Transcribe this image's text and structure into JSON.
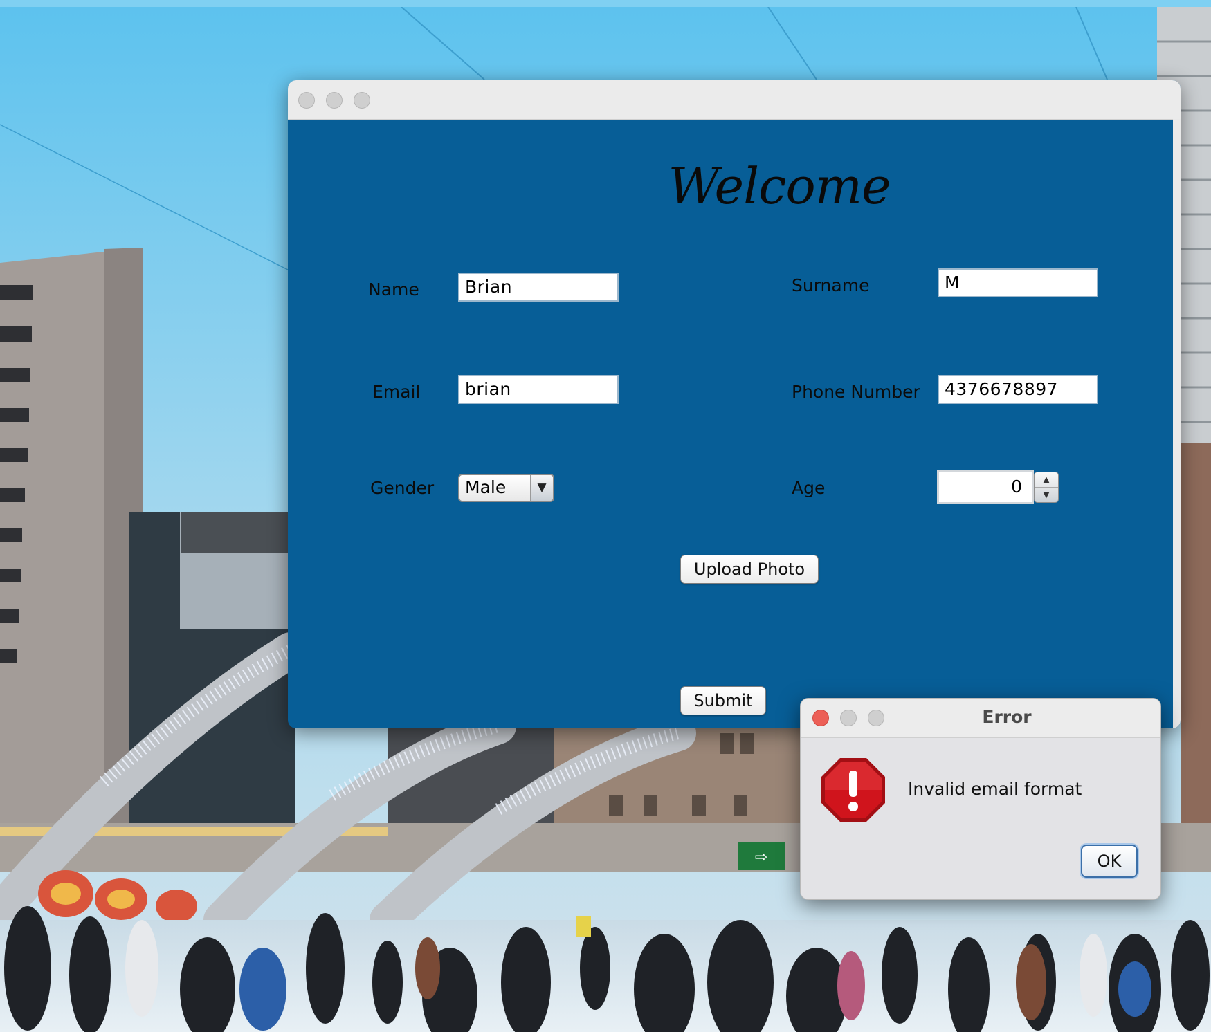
{
  "form_window": {
    "heading": "Welcome",
    "fields": {
      "name": {
        "label": "Name",
        "value": "Brian"
      },
      "surname": {
        "label": "Surname",
        "value": "M"
      },
      "email": {
        "label": "Email",
        "value": "brian"
      },
      "phone": {
        "label": "Phone Number",
        "value": "4376678897"
      },
      "gender": {
        "label": "Gender",
        "selected": "Male"
      },
      "age": {
        "label": "Age",
        "value": "0"
      }
    },
    "upload_button": "Upload Photo",
    "submit_button": "Submit",
    "background_color": "#075e97"
  },
  "error_dialog": {
    "title": "Error",
    "message": "Invalid email format",
    "ok_button": "OK",
    "icon": "error-stop-icon",
    "icon_color": "#d0141c"
  }
}
